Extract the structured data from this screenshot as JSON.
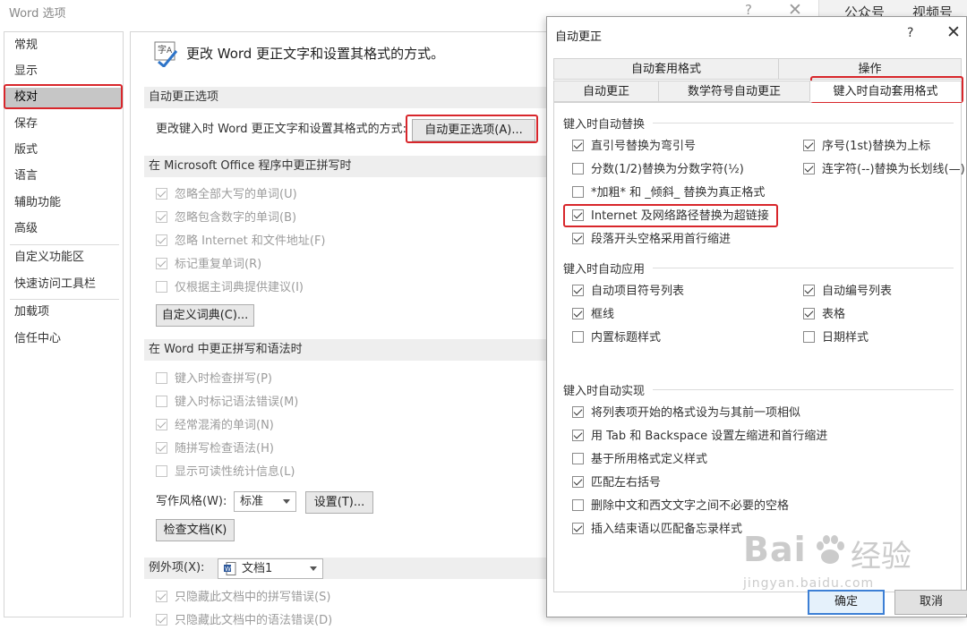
{
  "back_window": {
    "title": "Word 选项",
    "help": "?",
    "close": "✕",
    "top_tabs": [
      "公众号",
      "视频号"
    ]
  },
  "nav": {
    "items": [
      "常规",
      "显示",
      "校对",
      "保存",
      "版式",
      "语言",
      "辅助功能",
      "高级",
      "自定义功能区",
      "快速访问工具栏",
      "加载项",
      "信任中心"
    ],
    "selected": "校对"
  },
  "content": {
    "header": "更改 Word 更正文字和设置其格式的方式。",
    "section_autocorrect": "自动更正选项",
    "autocorrect_desc": "更改键入时 Word 更正文字和设置其格式的方式:",
    "autocorrect_button": "自动更正选项(A)...",
    "section_office": "在 Microsoft Office 程序中更正拼写时",
    "office_options": [
      {
        "label": "忽略全部大写的单词(U)",
        "checked": true
      },
      {
        "label": "忽略包含数字的单词(B)",
        "checked": true
      },
      {
        "label": "忽略 Internet 和文件地址(F)",
        "checked": true
      },
      {
        "label": "标记重复单词(R)",
        "checked": true
      },
      {
        "label": "仅根据主词典提供建议(I)",
        "checked": false
      }
    ],
    "custom_dict_button": "自定义词典(C)...",
    "section_word": "在 Word 中更正拼写和语法时",
    "word_options": [
      {
        "label": "键入时检查拼写(P)",
        "checked": false
      },
      {
        "label": "键入时标记语法错误(M)",
        "checked": false
      },
      {
        "label": "经常混淆的单词(N)",
        "checked": true
      },
      {
        "label": "随拼写检查语法(H)",
        "checked": true
      },
      {
        "label": "显示可读性统计信息(L)",
        "checked": false
      }
    ],
    "writing_style_label": "写作风格(W):",
    "writing_style_value": "标准",
    "settings_button": "设置(T)...",
    "check_doc_button": "检查文档(K)",
    "exceptions_label": "例外项(X):",
    "exceptions_value": "文档1",
    "exception_options": [
      {
        "label": "只隐藏此文档中的拼写错误(S)",
        "checked": true
      },
      {
        "label": "只隐藏此文档中的语法错误(D)",
        "checked": true
      }
    ]
  },
  "dialog": {
    "title": "自动更正",
    "help": "?",
    "close": "✕",
    "tabs_row1": [
      "自动套用格式",
      "操作"
    ],
    "tabs_row2": [
      "自动更正",
      "数学符号自动更正",
      "键入时自动套用格式"
    ],
    "active_tab": "键入时自动套用格式",
    "group1_title": "键入时自动替换",
    "group1_left": [
      {
        "label": "直引号替换为弯引号",
        "checked": true
      },
      {
        "label": "分数(1/2)替换为分数字符(½)",
        "checked": false
      },
      {
        "label": "*加粗* 和 _倾斜_ 替换为真正格式",
        "checked": false
      },
      {
        "label": "Internet 及网络路径替换为超链接",
        "checked": true
      },
      {
        "label": "段落开头空格采用首行缩进",
        "checked": true
      }
    ],
    "group1_right": [
      {
        "label": "序号(1st)替换为上标",
        "checked": true
      },
      {
        "label": "连字符(--)替换为长划线(—)",
        "checked": true
      }
    ],
    "group2_title": "键入时自动应用",
    "group2_left": [
      {
        "label": "自动项目符号列表",
        "checked": true
      },
      {
        "label": "框线",
        "checked": true
      },
      {
        "label": "内置标题样式",
        "checked": false
      }
    ],
    "group2_right": [
      {
        "label": "自动编号列表",
        "checked": true
      },
      {
        "label": "表格",
        "checked": true
      },
      {
        "label": "日期样式",
        "checked": false
      }
    ],
    "group3_title": "键入时自动实现",
    "group3": [
      {
        "label": "将列表项开始的格式设为与其前一项相似",
        "checked": true
      },
      {
        "label": "用 Tab 和 Backspace 设置左缩进和首行缩进",
        "checked": true
      },
      {
        "label": "基于所用格式定义样式",
        "checked": false
      },
      {
        "label": "匹配左右括号",
        "checked": true
      },
      {
        "label": "删除中文和西文文字之间不必要的空格",
        "checked": false
      },
      {
        "label": "插入结束语以匹配备忘录样式",
        "checked": true
      }
    ],
    "ok_button": "确定",
    "cancel_button": "取消"
  },
  "watermark": {
    "brand": "Bai",
    "brand_cn": "经验",
    "url": "jingyan.baidu.com"
  },
  "colors": {
    "highlight_red": "#d8262b",
    "selected_nav": "#c6c6c6",
    "default_button_border": "#3c7fd5"
  }
}
